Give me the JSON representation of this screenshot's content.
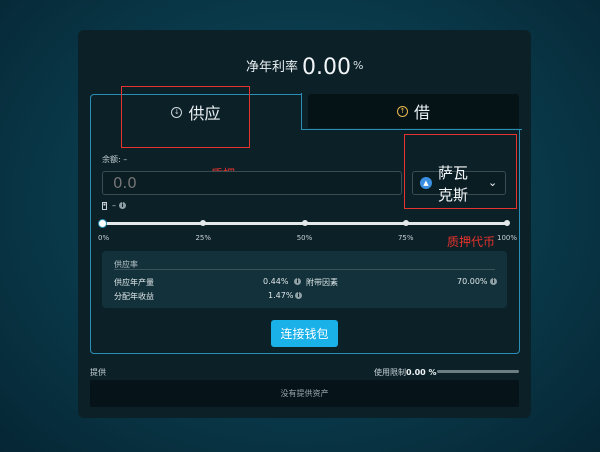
{
  "header": {
    "apy_label": "净年利率",
    "apy_value": "0.00",
    "apy_unit": "%"
  },
  "tabs": {
    "supply_label": "供应",
    "borrow_label": "借"
  },
  "annotations": {
    "collateral": "质押",
    "collateral_token": "质押代币"
  },
  "form": {
    "balance_label": "余额: –",
    "amount_placeholder": "0.0",
    "asset_name": "萨瓦克斯",
    "gas_label": "–"
  },
  "slider": {
    "value_percent": 0,
    "marks": [
      "0%",
      "25%",
      "50%",
      "75%",
      "100%"
    ]
  },
  "info": {
    "title": "供应率",
    "supply_apy_label": "供应年产量",
    "supply_apy_value": "0.44%",
    "distribution_label": "分配年收益",
    "distribution_value": "1.47%",
    "collateral_factor_label": "附带因素",
    "collateral_factor_value": "70.00%"
  },
  "actions": {
    "connect_wallet": "连接钱包"
  },
  "supply_list": {
    "label": "提供",
    "usage_label": "使用限制",
    "usage_value": "0.00 %",
    "usage_fraction": 0,
    "empty_text": "没有提供资产"
  },
  "colors": {
    "accent": "#1ab0e8",
    "panel_border": "#2a8fb7",
    "annotation_red": "#e5332d",
    "borrow_icon": "#e9b84c"
  }
}
